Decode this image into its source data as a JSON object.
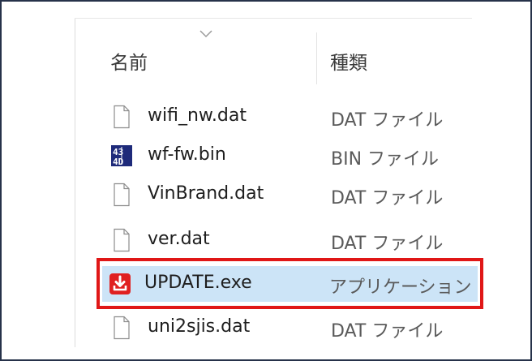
{
  "columns": {
    "name_label": "名前",
    "type_label": "種類"
  },
  "files": [
    {
      "name": "wifi_nw.dat",
      "type": "DAT ファイル",
      "icon": "document-icon",
      "selected": false
    },
    {
      "name": "wf-fw.bin",
      "type": "BIN ファイル",
      "icon": "binary-file-icon",
      "selected": false
    },
    {
      "name": "VinBrand.dat",
      "type": "DAT ファイル",
      "icon": "document-icon",
      "selected": false
    },
    {
      "name": "ver.dat",
      "type": "DAT ファイル",
      "icon": "document-icon",
      "selected": false
    },
    {
      "name": "UPDATE.exe",
      "type": "アプリケーション",
      "icon": "download-app-icon",
      "selected": true
    },
    {
      "name": "uni2sjis.dat",
      "type": "DAT ファイル",
      "icon": "document-icon",
      "selected": false
    }
  ],
  "colors": {
    "selection_bg": "#cce4f7",
    "highlight_border": "#e01717",
    "frame_border": "#26324a",
    "bin_icon": "#1e2a7a",
    "app_icon": "#e02020"
  }
}
